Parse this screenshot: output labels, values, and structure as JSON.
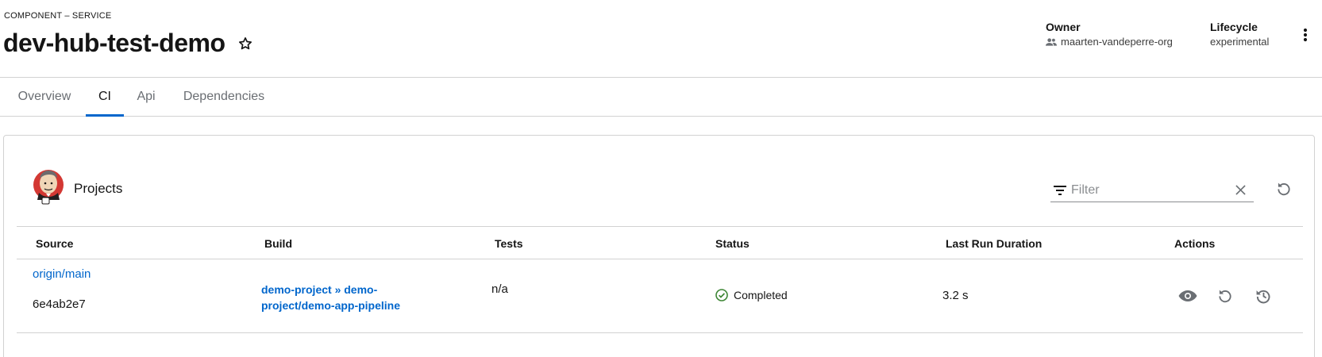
{
  "header": {
    "kind": "COMPONENT – SERVICE",
    "title": "dev-hub-test-demo",
    "owner_label": "Owner",
    "owner_value": "maarten-vandeperre-org",
    "lifecycle_label": "Lifecycle",
    "lifecycle_value": "experimental"
  },
  "tabs": [
    {
      "label": "Overview",
      "active": false
    },
    {
      "label": "CI",
      "active": true
    },
    {
      "label": "Api",
      "active": false
    },
    {
      "label": "Dependencies",
      "active": false
    }
  ],
  "projects": {
    "title": "Projects",
    "filter_placeholder": "Filter",
    "columns": [
      "Source",
      "Build",
      "Tests",
      "Status",
      "Last Run Duration",
      "Actions"
    ],
    "rows": [
      {
        "source_branch": "origin/main",
        "source_commit": "6e4ab2e7",
        "build_line1": "demo-project » demo-",
        "build_line2": "project/demo-app-pipeline",
        "tests": "n/a",
        "status": "Completed",
        "duration": "3.2 s"
      }
    ]
  },
  "colors": {
    "accent": "#0066cc",
    "success": "#3e8635",
    "border": "#d2d2d2",
    "muted": "#6a6e73"
  },
  "icons": [
    "star-icon",
    "users-icon",
    "kebab-icon",
    "jenkins-logo",
    "filter-icon",
    "close-icon",
    "refresh-icon",
    "check-circle-icon",
    "eye-icon",
    "rerun-icon",
    "history-icon"
  ]
}
